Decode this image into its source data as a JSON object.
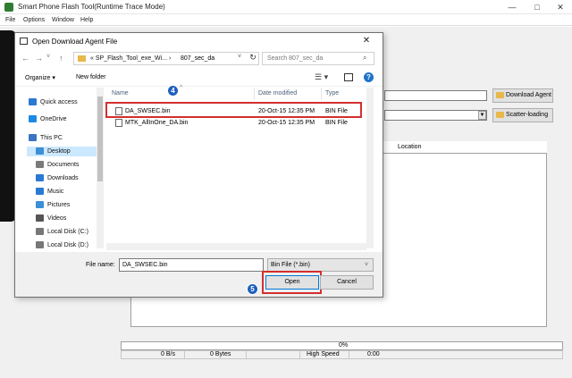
{
  "app": {
    "title": "Smart Phone Flash Tool(Runtime Trace Mode)",
    "window_controls": [
      "—",
      "□",
      "✕"
    ],
    "menu": [
      "File",
      "Options",
      "Window",
      "Help"
    ],
    "buttons": {
      "download_agent": "Download Agent",
      "scatter_loading": "Scatter-loading"
    },
    "table": {
      "location_header": "Location"
    },
    "progress": {
      "percent_text": "0%",
      "value": 0
    },
    "status": {
      "speed": "0 B/s",
      "bytes": "0 Bytes",
      "mode": "High Speed",
      "time": "0:00"
    }
  },
  "dialog": {
    "title": "Open Download Agent File",
    "close": "✕",
    "nav": {
      "back": "←",
      "forward": "→",
      "up": "↑",
      "down_arrow": "˅"
    },
    "address": {
      "prefix": "«",
      "segment1": "SP_Flash_Tool_exe_Wi...",
      "sep": "›",
      "segment2": "807_sec_da",
      "dropdown": "˅",
      "refresh": "↻"
    },
    "search": {
      "placeholder": "Search 807_sec_da",
      "icon": "⌕"
    },
    "toolbar": {
      "organize": "Organize ▾",
      "new_folder": "New folder",
      "view_icon": "☰ ▾",
      "help_icon": "?"
    },
    "nav_pane": [
      {
        "label": "Quick access",
        "icon": "star-icon"
      },
      {
        "label": "OneDrive",
        "icon": "cloud-icon"
      },
      {
        "label": "This PC",
        "icon": "computer-icon"
      },
      {
        "label": "Desktop",
        "icon": "desktop-icon",
        "selected": true
      },
      {
        "label": "Documents",
        "icon": "documents-icon"
      },
      {
        "label": "Downloads",
        "icon": "downloads-icon"
      },
      {
        "label": "Music",
        "icon": "music-icon"
      },
      {
        "label": "Pictures",
        "icon": "pictures-icon"
      },
      {
        "label": "Videos",
        "icon": "videos-icon"
      },
      {
        "label": "Local Disk (C:)",
        "icon": "drive-icon"
      },
      {
        "label": "Local Disk (D:)",
        "icon": "drive-icon"
      }
    ],
    "columns": [
      "Name",
      "Date modified",
      "Type"
    ],
    "files": [
      {
        "name": "DA_SWSEC.bin",
        "date": "20-Oct-15 12:35 PM",
        "type": "BIN File"
      },
      {
        "name": "MTK_AllInOne_DA.bin",
        "date": "20-Oct-15 12:35 PM",
        "type": "BIN File"
      }
    ],
    "file_name_label": "File name:",
    "file_name_value": "DA_SWSEC.bin",
    "file_type": "Bin File (*.bin)",
    "open_label": "Open",
    "cancel_label": "Cancel"
  },
  "annotations": {
    "step4": "4",
    "step5": "5",
    "highlight_color": "#d32f2f",
    "badge_color": "#1f5fbf"
  }
}
